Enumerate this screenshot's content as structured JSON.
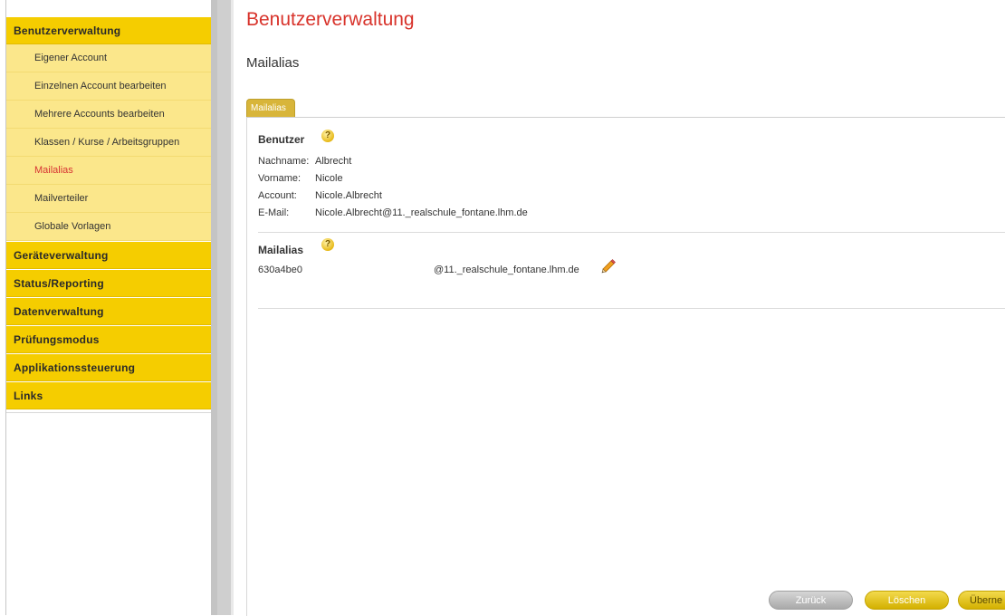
{
  "sidebar": {
    "sections": [
      {
        "label": "Benutzerverwaltung"
      },
      {
        "label": "Geräteverwaltung"
      },
      {
        "label": "Status/Reporting"
      },
      {
        "label": "Datenverwaltung"
      },
      {
        "label": "Prüfungsmodus"
      },
      {
        "label": "Applikationssteuerung"
      },
      {
        "label": "Links"
      }
    ],
    "sub_items": [
      {
        "label": "Eigener Account"
      },
      {
        "label": "Einzelnen Account bearbeiten"
      },
      {
        "label": "Mehrere Accounts bearbeiten"
      },
      {
        "label": "Klassen / Kurse / Arbeitsgruppen"
      },
      {
        "label": "Mailalias",
        "active": true
      },
      {
        "label": "Mailverteiler"
      },
      {
        "label": "Globale Vorlagen"
      }
    ]
  },
  "main": {
    "page_title": "Benutzerverwaltung",
    "sub_title": "Mailalias",
    "tab_label": "Mailalias",
    "user_section": {
      "heading": "Benutzer",
      "help": "?",
      "fields": [
        {
          "label": "Nachname:",
          "value": "Albrecht"
        },
        {
          "label": "Vorname:",
          "value": "Nicole"
        },
        {
          "label": "Account:",
          "value": "Nicole.Albrecht"
        },
        {
          "label": "E-Mail:",
          "value": "Nicole.Albrecht@11._realschule_fontane.lhm.de"
        }
      ]
    },
    "alias_section": {
      "heading": "Mailalias",
      "help": "?",
      "alias_local": "630a4be0",
      "alias_domain": "@11._realschule_fontane.lhm.de",
      "edit_icon": "pencil-icon"
    }
  },
  "buttons": {
    "back": "Zurück",
    "delete": "Löschen",
    "apply": "Überne"
  },
  "colors": {
    "accent_yellow": "#f5cd00",
    "sub_yellow": "#fbe78b",
    "title_red": "#d8332b",
    "active_red": "#d63333"
  }
}
